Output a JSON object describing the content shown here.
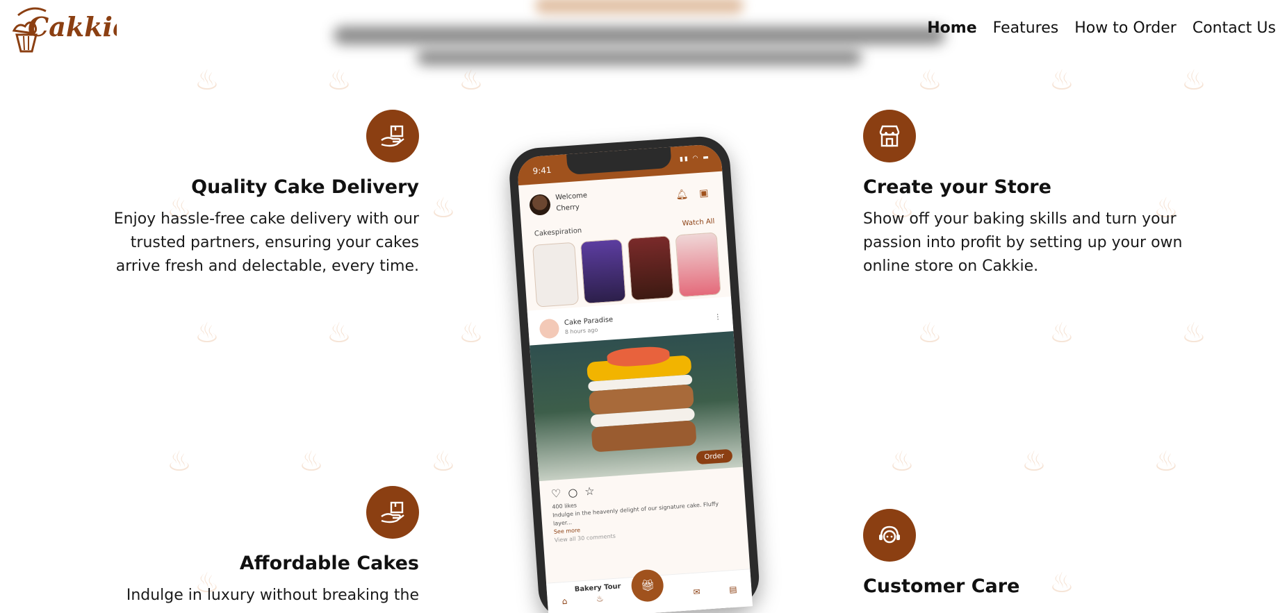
{
  "brand": {
    "name": "Cakkie",
    "accent": "#8b3f12"
  },
  "nav": {
    "items": [
      {
        "label": "Home",
        "active": true
      },
      {
        "label": "Features",
        "active": false
      },
      {
        "label": "How to Order",
        "active": false
      },
      {
        "label": "Contact Us",
        "active": false
      }
    ]
  },
  "features": [
    {
      "title": "Quality Cake Delivery",
      "description": "Enjoy hassle-free cake delivery with our trusted partners, ensuring your cakes arrive fresh and delectable, every time.",
      "icon": "delivery-hand-icon"
    },
    {
      "title": "Create your Store",
      "description": "Show off your baking skills and turn your passion into profit by setting up your own online store on Cakkie.",
      "icon": "store-icon"
    },
    {
      "title": "Affordable Cakes",
      "description": "Indulge in luxury without breaking the",
      "icon": "delivery-hand-icon"
    },
    {
      "title": "Customer Care",
      "description": "",
      "icon": "support-agent-icon"
    }
  ],
  "phone": {
    "time": "9:41",
    "welcome": "Welcome",
    "user": "Cherry",
    "section_title": "Cakespiration",
    "watch_all": "Watch All",
    "post_author": "Cake Paradise",
    "post_time": "8 hours ago",
    "order_label": "Order",
    "likes": "400 likes",
    "caption": "Indulge in the heavenly delight of our signature cake. Fluffy layer...",
    "see_more": "See more",
    "comments": "View all 30 comments",
    "next_author": "Bakery Tour",
    "center_tab": "Shop",
    "tab_chats": "Chats",
    "tab_orders": "Orders"
  }
}
